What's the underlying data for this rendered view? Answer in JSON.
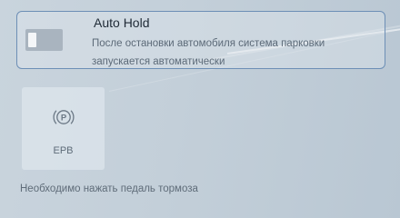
{
  "auto_hold": {
    "title": "Auto Hold",
    "description": "После остановки автомобиля система парковки запускается автоматически",
    "toggle_state": "off"
  },
  "epb": {
    "label": "EPB",
    "icon": "parking-brake-icon"
  },
  "hint": "Необходимо нажать педаль тормоза",
  "colors": {
    "card_border": "#6d8fb6",
    "toggle_off": "#a9b4bf"
  }
}
